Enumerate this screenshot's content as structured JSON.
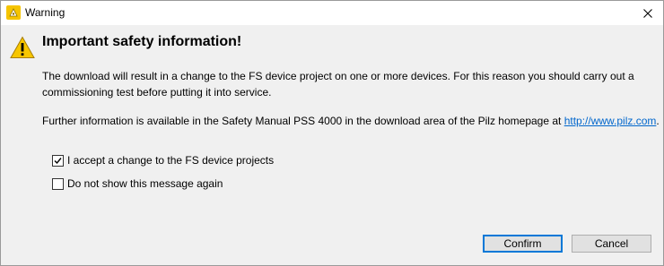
{
  "window": {
    "title": "Warning"
  },
  "icons": {
    "app": "pilz-app-icon",
    "close": "close-icon",
    "warning": "warning-triangle-icon"
  },
  "dialog": {
    "heading": "Important safety information!",
    "paragraph1": "The download will result in a change to the FS device project on one or more devices. For this reason you should carry out a commissioning test before putting it into service.",
    "paragraph2_prefix": "Further information is available in the Safety Manual PSS 4000 in the download area of the Pilz homepage at ",
    "link_text": "http://www.pilz.com",
    "paragraph2_suffix": ".",
    "checkboxes": [
      {
        "label": "I accept a change to the FS device projects",
        "checked": true
      },
      {
        "label": "Do not show this message again",
        "checked": false
      }
    ],
    "buttons": {
      "confirm": "Confirm",
      "cancel": "Cancel"
    }
  },
  "colors": {
    "link": "#0066cc",
    "warning_yellow": "#f7c600",
    "primary_border": "#0078d7"
  }
}
